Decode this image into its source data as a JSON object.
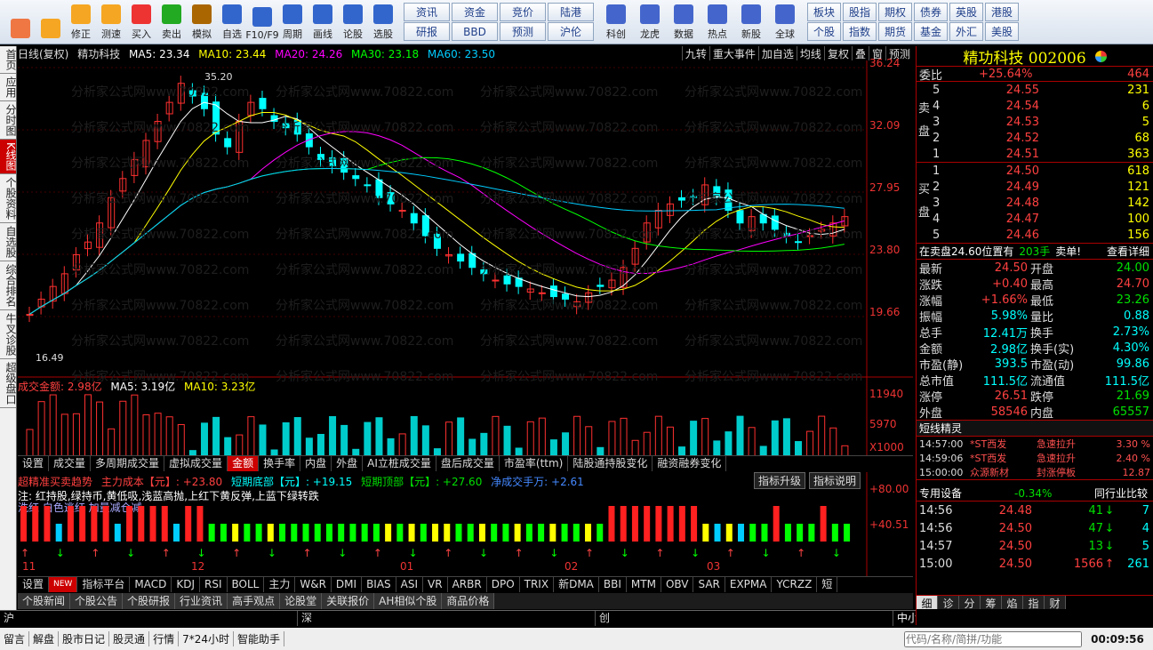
{
  "toolbar": {
    "buttons": [
      {
        "label": "",
        "icon": "home-icon",
        "color": "#e74"
      },
      {
        "label": "",
        "icon": "back-arrow-icon",
        "color": "#f5a623"
      },
      {
        "label": "修正",
        "icon": "up-down-icon",
        "color": "#f5a623"
      },
      {
        "label": "测速",
        "icon": "speed-icon",
        "color": "#f5a623"
      },
      {
        "label": "测速",
        "icon": "clock-icon",
        "color": "#e33"
      },
      {
        "label": "买入",
        "icon": "buy-icon",
        "color": "#e33"
      },
      {
        "label": "卖出",
        "icon": "sell-icon",
        "color": "#2a2"
      },
      {
        "label": "模拟",
        "icon": "hammer-icon",
        "color": "#a60"
      },
      {
        "label": "自选",
        "icon": "star-icon",
        "color": "#36c"
      },
      {
        "label": "F10/F9",
        "icon": "f10-icon",
        "color": "#36c"
      },
      {
        "label": "周期",
        "icon": "period-icon",
        "color": "#36c"
      },
      {
        "label": "画线",
        "icon": "pencil-icon",
        "color": "#36c"
      },
      {
        "label": "论股",
        "icon": "talk-icon",
        "color": "#36c"
      },
      {
        "label": "选股",
        "icon": "select-icon",
        "color": "#36c"
      }
    ],
    "grid_left": [
      "资讯",
      "资金",
      "竞价",
      "陆港",
      "研报",
      "BBD",
      "预测",
      "沪伦"
    ],
    "buttons2": [
      {
        "label": "科创",
        "icon": "kechuang-icon"
      },
      {
        "label": "龙虎",
        "icon": "dragon-icon"
      },
      {
        "label": "数据",
        "icon": "pe-icon"
      },
      {
        "label": "热点",
        "icon": "fire-icon"
      },
      {
        "label": "新股",
        "icon": "ipo-icon"
      },
      {
        "label": "全球",
        "icon": "globe-icon"
      }
    ],
    "grid_right": [
      "板块",
      "股指",
      "期权",
      "债券",
      "英股",
      "港股",
      "个股",
      "指数",
      "期货",
      "基金",
      "外汇",
      "美股"
    ]
  },
  "sidebar": [
    "首页",
    "应用",
    "分时图",
    "K线图",
    "个股资料",
    "自选股",
    "综合排名",
    "牛叉诊股",
    "超级盘口"
  ],
  "chart": {
    "header": [
      "日线(复权)",
      "精功科技",
      "MA5: 23.34",
      "MA10: 23.44",
      "MA20: 24.26",
      "MA30: 23.18",
      "MA60: 23.50"
    ],
    "controls": [
      "九转",
      "重大事件",
      "加自选",
      "均线",
      "复权",
      "叠",
      "窗",
      "预测"
    ],
    "yaxis": [
      "36.24",
      "32.09",
      "27.95",
      "23.80",
      "19.66"
    ],
    "high_label": "35.20",
    "low_label": "16.49",
    "vol_header": [
      "成交金额: 2.98亿",
      "MA5: 3.19亿",
      "MA10: 3.23亿"
    ],
    "vol_axis": [
      "11940",
      "5970",
      "X1000"
    ],
    "ind_axis": [
      "+80.00",
      "+40.51"
    ],
    "months": [
      "11",
      "12",
      "01",
      "02",
      "03"
    ],
    "ind_header": [
      "超精准买卖趋势",
      "主力成本【元】: +23.80",
      "短期底部【元】: +19.15",
      "短期顶部【元】: +27.60",
      "净成交手万: +2.61"
    ],
    "ind_note": "注: 红持股,绿持币,黄低吸,浅蓝高抛,上红下黄反弹,上蓝下绿转跌",
    "ind_note2": "洗红 白色逃红 加量减仓减",
    "ind_buttons": [
      "指标升级",
      "指标说明"
    ],
    "watermark": "分析家公式网www.70822.com"
  },
  "chart_data": {
    "type": "candlestick",
    "ylim": [
      16.49,
      36.24
    ],
    "ma": {
      "MA5": 23.34,
      "MA10": 23.44,
      "MA20": 24.26,
      "MA30": 23.18,
      "MA60": 23.5
    },
    "high": 35.2,
    "low": 16.49
  },
  "tabs1": [
    "设置",
    "成交量",
    "多周期成交量",
    "虚拟成交量",
    "金额",
    "换手率",
    "内盘",
    "外盘",
    "AI立桩成交量",
    "盘后成交量",
    "市盈率(ttm)",
    "陆股通持股变化",
    "融资融券变化"
  ],
  "tabs2": [
    "设置",
    "NEW",
    "指标平台",
    "MACD",
    "KDJ",
    "RSI",
    "BOLL",
    "主力",
    "W&R",
    "DMI",
    "BIAS",
    "ASI",
    "VR",
    "ARBR",
    "DPO",
    "TRIX",
    "新DMA",
    "BBI",
    "MTM",
    "OBV",
    "SAR",
    "EXPMA",
    "YCRZZ",
    "短"
  ],
  "news": [
    "个股新闻",
    "个股公告",
    "个股研报",
    "行业资讯",
    "高手观点",
    "论股堂",
    "关联报价",
    "AH相似个股",
    "商品价格"
  ],
  "status": [
    "沪",
    "深",
    "创",
    "中小板指"
  ],
  "bottom": [
    "留言",
    "解盘",
    "股市日记",
    "股灵通",
    "行情",
    "7*24小时",
    "智能助手"
  ],
  "bottom_right": {
    "input_placeholder": "代码/名称/简拼/功能",
    "time": "00:09:56"
  },
  "quote": {
    "title": "精功科技 002006",
    "webi_label": "委比",
    "webi": "+25.64%",
    "webi_val": "464",
    "sell": [
      [
        "5",
        "24.55",
        "231"
      ],
      [
        "4",
        "24.54",
        "6"
      ],
      [
        "3",
        "24.53",
        "5"
      ],
      [
        "2",
        "24.52",
        "68"
      ],
      [
        "1",
        "24.51",
        "363"
      ]
    ],
    "buy": [
      [
        "1",
        "24.50",
        "618"
      ],
      [
        "2",
        "24.49",
        "121"
      ],
      [
        "3",
        "24.48",
        "142"
      ],
      [
        "4",
        "24.47",
        "100"
      ],
      [
        "5",
        "24.46",
        "156"
      ]
    ],
    "sell_side": "卖盘",
    "buy_side": "买盘",
    "info": "在卖盘24.60位置有",
    "info_num": "203手",
    "info_tag": "卖单!",
    "info_link": "查看详细",
    "stats": [
      [
        "最新",
        "24.50",
        "开盘",
        "24.00"
      ],
      [
        "涨跌",
        "+0.40",
        "最高",
        "24.70"
      ],
      [
        "涨幅",
        "+1.66%",
        "最低",
        "23.26"
      ],
      [
        "振幅",
        "5.98%",
        "量比",
        "0.88"
      ],
      [
        "总手",
        "12.41万",
        "换手",
        "2.73%"
      ],
      [
        "金额",
        "2.98亿",
        "换手(实)",
        "4.30%"
      ],
      [
        "市盈(静)",
        "393.5",
        "市盈(动)",
        "99.86"
      ],
      [
        "总市值",
        "111.5亿",
        "流通值",
        "111.5亿"
      ],
      [
        "涨停",
        "26.51",
        "跌停",
        "21.69"
      ],
      [
        "外盘",
        "58546",
        "内盘",
        "65557"
      ]
    ],
    "elf_title": "短线精灵",
    "elf": [
      [
        "14:57:00",
        "*ST西发",
        "急速拉升",
        "3.30 %"
      ],
      [
        "14:59:06",
        "*ST西发",
        "急速拉升",
        "2.40 %"
      ],
      [
        "15:00:00",
        "众源新材",
        "封涨停板",
        "12.87"
      ]
    ],
    "sector_name": "专用设备",
    "sector_change": "-0.34%",
    "sector_link": "同行业比较",
    "ticks": [
      [
        "14:56",
        "24.48",
        "41",
        "7"
      ],
      [
        "14:56",
        "24.50",
        "47",
        "4"
      ],
      [
        "14:57",
        "24.50",
        "13",
        "5"
      ],
      [
        "15:00",
        "24.50",
        "1566",
        "261"
      ]
    ],
    "tick_tabs": [
      "细",
      "诊",
      "分",
      "筹",
      "焰",
      "指",
      "财"
    ]
  }
}
